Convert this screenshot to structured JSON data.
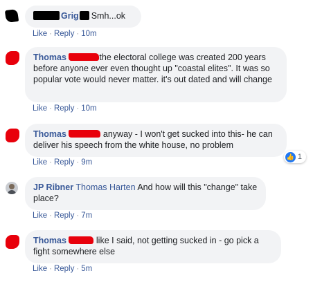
{
  "comments": [
    {
      "name": "Grig",
      "text": "Smh...ok",
      "actions": {
        "like": "Like",
        "reply": "Reply",
        "time": "10m"
      }
    },
    {
      "name": "Thomas",
      "text": "the electoral college was created 200 years before anyone ever even thought up \"coastal elites\". It was so popular vote would never matter. it's out dated and will change",
      "actions": {
        "like": "Like",
        "reply": "Reply",
        "time": "10m"
      }
    },
    {
      "name": "Thomas",
      "text": "anyway - I won't get sucked into this- he can deliver his speech from the white house, no problem",
      "actions": {
        "like": "Like",
        "reply": "Reply",
        "time": "9m"
      },
      "reaction": {
        "icon": "thumbs-up-icon",
        "count": "1"
      }
    },
    {
      "name": "JP Ribner",
      "tag": "Thomas Harten",
      "text": "And how will this \"change\" take place?",
      "actions": {
        "like": "Like",
        "reply": "Reply",
        "time": "7m"
      }
    },
    {
      "name": "Thomas",
      "text": "like I said, not getting sucked in - go pick a fight somewhere else",
      "actions": {
        "like": "Like",
        "reply": "Reply",
        "time": "5m"
      }
    }
  ],
  "separator": "·",
  "colors": {
    "link": "#385898",
    "bubble": "#f2f3f5",
    "redaction_red": "#e8000b",
    "like_blue": "#2078f4"
  }
}
